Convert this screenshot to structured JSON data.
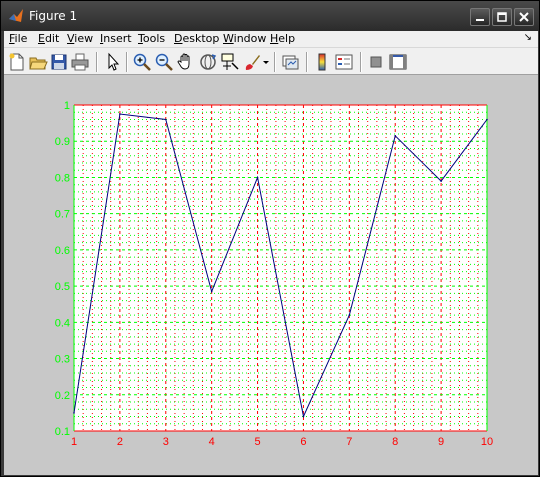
{
  "window": {
    "title": "Figure 1"
  },
  "menubar": {
    "items": [
      {
        "label": "File",
        "key": "F",
        "rest": "ile"
      },
      {
        "label": "Edit",
        "key": "E",
        "rest": "dit"
      },
      {
        "label": "View",
        "key": "V",
        "rest": "iew"
      },
      {
        "label": "Insert",
        "key": "I",
        "rest": "nsert"
      },
      {
        "label": "Tools",
        "key": "T",
        "rest": "ools"
      },
      {
        "label": "Desktop",
        "key": "D",
        "rest": "esktop"
      },
      {
        "label": "Window",
        "key": "W",
        "rest": "indow"
      },
      {
        "label": "Help",
        "key": "H",
        "rest": "elp"
      }
    ],
    "dock_arrow": "↘"
  },
  "toolbar": {
    "icons": [
      "new-figure-icon",
      "open-file-icon",
      "save-icon",
      "print-icon",
      "edit-plot-arrow-icon",
      "zoom-in-icon",
      "zoom-out-icon",
      "pan-hand-icon",
      "rotate-3d-icon",
      "data-cursor-icon",
      "brush-icon",
      "brush-dropdown-icon",
      "link-plot-icon",
      "colorbar-icon",
      "legend-icon",
      "hide-plot-tools-icon",
      "show-plot-tools-icon"
    ]
  },
  "colors": {
    "figure_bg": "#c8c8c8",
    "axes_bg": "#ffffff",
    "x_axis_color": "#ff0000",
    "y_axis_color": "#00ff00",
    "line_color": "#000080"
  },
  "chart_data": {
    "type": "line",
    "title": "",
    "xlabel": "",
    "ylabel": "",
    "xlim": [
      1,
      10
    ],
    "ylim": [
      0.1,
      1
    ],
    "xticks": [
      1,
      2,
      3,
      4,
      5,
      6,
      7,
      8,
      9,
      10
    ],
    "xtick_labels": [
      "1",
      "2",
      "3",
      "4",
      "5",
      "6",
      "7",
      "8",
      "9",
      "10"
    ],
    "yticks": [
      0.1,
      0.2,
      0.3,
      0.4,
      0.5,
      0.6,
      0.7,
      0.8,
      0.9,
      1
    ],
    "ytick_labels": [
      "0.1",
      "0.2",
      "0.3",
      "0.4",
      "0.5",
      "0.6",
      "0.7",
      "0.8",
      "0.9",
      "1"
    ],
    "grid": true,
    "minor_grid": true,
    "series": [
      {
        "x": [
          1,
          2,
          3,
          4,
          5,
          6,
          7,
          8,
          9,
          10
        ],
        "values": [
          0.15,
          0.975,
          0.96,
          0.485,
          0.8,
          0.14,
          0.42,
          0.915,
          0.79,
          0.96
        ]
      }
    ]
  }
}
